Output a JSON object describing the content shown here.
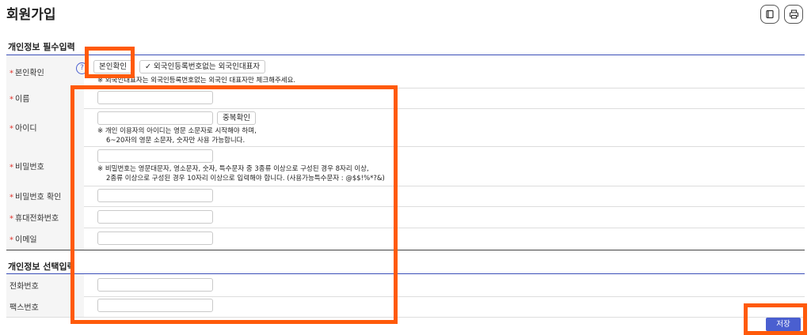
{
  "page": {
    "title": "회원가입",
    "icons": [
      "book-icon",
      "print-icon"
    ]
  },
  "required_section": {
    "title": "개인정보 필수입력",
    "identity": {
      "label": "본인확인",
      "required_mark": "*",
      "help": "?",
      "verify_button": "본인확인",
      "foreign_button": "외국인등록번호없는 외국인대표자",
      "foreign_check": "✓",
      "note": "※ 외국인대표자는 외국인등록번호없는 외국인 대표자만 체크해주세요."
    },
    "name": {
      "label": "이름",
      "required_mark": "*",
      "value": ""
    },
    "user_id": {
      "label": "아이디",
      "required_mark": "*",
      "value": "",
      "check_button": "중복확인",
      "note_line1": "※ 개인 이용자의 아이디는 영문 소문자로 시작해야 하며,",
      "note_line2": "6~20자의 영문 소문자, 숫자만 사용 가능합니다."
    },
    "password": {
      "label": "비밀번호",
      "required_mark": "*",
      "value": "",
      "note_line1": "※ 비밀번호는 영문대문자, 영소문자, 숫자, 특수문자 중 3종류 이상으로 구성된 경우 8자리 이상,",
      "note_line2": "2종류 이상으로 구성된 경우 10자리 이상으로 입력해야 합니다. (사용가능특수문자 : @$$!%*?&)"
    },
    "password_confirm": {
      "label": "비밀번호 확인",
      "required_mark": "*",
      "value": ""
    },
    "mobile": {
      "label": "휴대전화번호",
      "required_mark": "*",
      "value": ""
    },
    "email": {
      "label": "이메일",
      "required_mark": "*",
      "value": ""
    }
  },
  "optional_section": {
    "title": "개인정보 선택입력",
    "phone": {
      "label": "전화번호",
      "value": ""
    },
    "fax": {
      "label": "팩스번호",
      "value": ""
    }
  },
  "actions": {
    "save": "저장"
  },
  "colors": {
    "accent": "#4a5fd0",
    "highlight": "#ff5a0a",
    "required": "#e0322b"
  }
}
